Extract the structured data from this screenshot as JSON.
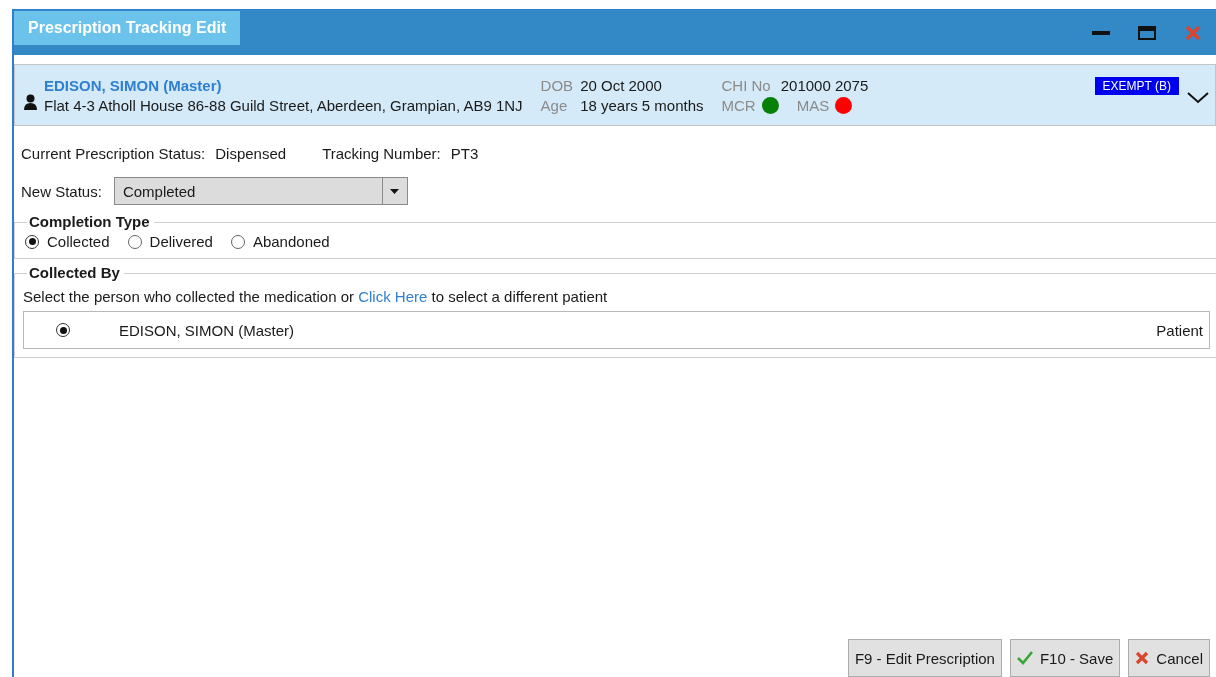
{
  "window": {
    "title": "Prescription Tracking Edit"
  },
  "patient": {
    "name": "EDISON, SIMON (Master)",
    "address": "Flat 4-3 Atholl House 86-88 Guild Street, Aberdeen, Grampian, AB9 1NJ",
    "dob_label": "DOB",
    "dob": "20 Oct 2000",
    "age_label": "Age",
    "age": "18 years 5 months",
    "chi_label": "CHI No",
    "chi": "201000 2075",
    "indicators": [
      {
        "label": "MCR",
        "color": "#078007"
      },
      {
        "label": "MAS",
        "color": "#ff0000"
      }
    ],
    "badge": "EXEMPT (B)"
  },
  "current_status": {
    "label": "Current Prescription Status:",
    "value": "Dispensed"
  },
  "tracking": {
    "label": "Tracking Number:",
    "value": "PT3"
  },
  "new_status": {
    "label": "New Status:",
    "value": "Completed"
  },
  "completion_type": {
    "title": "Completion Type",
    "options": [
      {
        "label": "Collected",
        "selected": true
      },
      {
        "label": "Delivered",
        "selected": false
      },
      {
        "label": "Abandoned",
        "selected": false
      }
    ]
  },
  "collected_by": {
    "title": "Collected By",
    "instruction": "Select the person who collected the medication or",
    "link": "Click Here",
    "instruction_end": "to select a different patient",
    "people": [
      {
        "name": "EDISON, SIMON (Master)",
        "role": "Patient",
        "selected": true
      }
    ]
  },
  "buttons": [
    {
      "label": "F9 - Edit Prescription",
      "kind": "plain"
    },
    {
      "label": "F10 - Save",
      "kind": "save"
    },
    {
      "label": "Cancel",
      "kind": "cancel"
    }
  ]
}
